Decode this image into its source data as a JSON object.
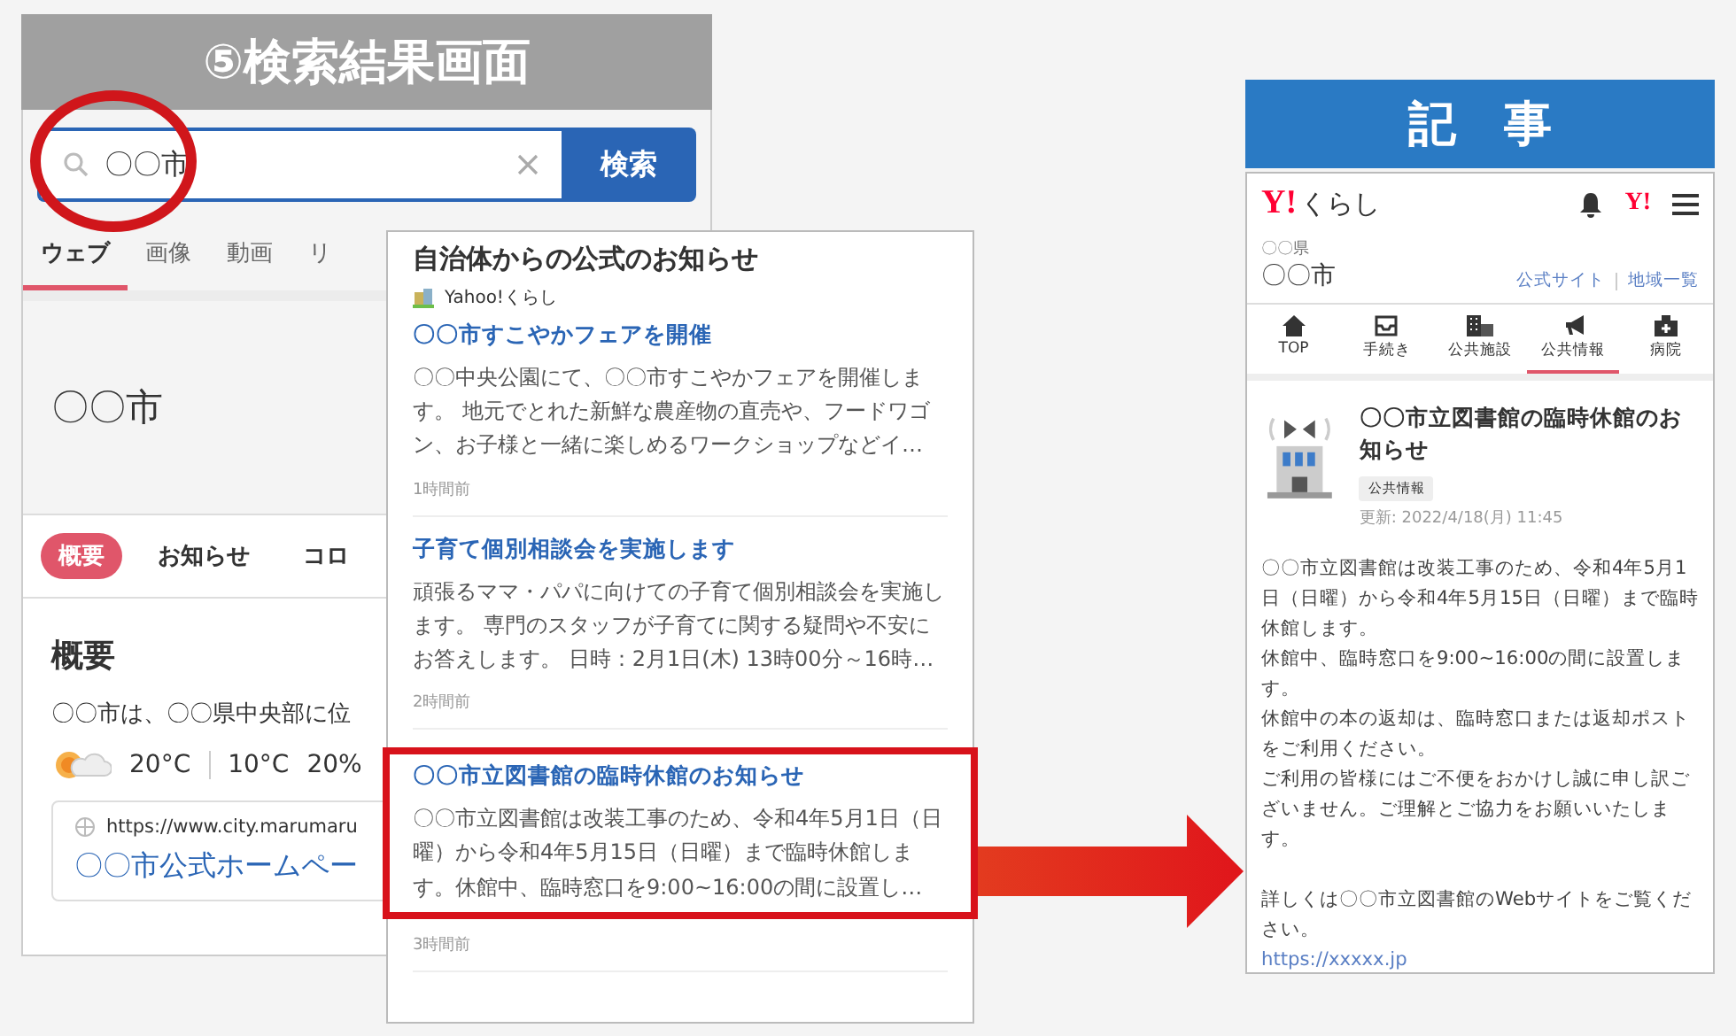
{
  "search_screen": {
    "title": "⑤検索結果画面",
    "search": {
      "value": "〇〇市",
      "button": "検索"
    },
    "tabs": [
      {
        "label": "ウェブ",
        "selected": true
      },
      {
        "label": "画像",
        "selected": false
      },
      {
        "label": "動画",
        "selected": false
      },
      {
        "label": "リ",
        "selected": false
      }
    ],
    "heading": "〇〇市",
    "chips": [
      {
        "label": "概要",
        "selected": true
      },
      {
        "label": "お知らせ",
        "selected": false
      },
      {
        "label": "コロ",
        "selected": false
      }
    ],
    "section_title": "概要",
    "summary": "〇〇市は、〇〇県中央部に位",
    "weather": {
      "high": "20°C",
      "low": "10°C",
      "rain": "20%"
    },
    "result": {
      "url": "https://www.city.marumaru",
      "title": "〇〇市公式ホームペー"
    }
  },
  "notices": {
    "title": "自治体からの公式のお知らせ",
    "source": "Yahoo!くらし",
    "items": [
      {
        "title": "〇〇市すこやかフェアを開催",
        "body": "〇〇中央公園にて、〇〇市すこやかフェアを開催します。 地元でとれた新鮮な農産物の直売や、フードワゴン、お子様と一緒に楽しめるワークショップなどイ…",
        "time": "1時間前",
        "highlighted": false
      },
      {
        "title": "子育て個別相談会を実施します",
        "body": "頑張るママ・パパに向けての子育て個別相談会を実施します。 専門のスタッフが子育てに関する疑問や不安にお答えします。 日時：2月1日(木) 13時00分～16時…",
        "time": "2時間前",
        "highlighted": false
      },
      {
        "title": "〇〇市立図書館の臨時休館のお知らせ",
        "body": "〇〇市立図書館は改装工事のため、令和4年5月1日（日曜）から令和4年5月15日（日曜）まで臨時休館します。休館中、臨時窓口を9:00~16:00の間に設置し…",
        "time": "3時間前",
        "highlighted": true
      }
    ]
  },
  "article_screen": {
    "title": "記　事",
    "logo": "Y!",
    "brand": "くらし",
    "account_logo": "Y!",
    "prefecture": "〇〇県",
    "city": "〇〇市",
    "links": [
      "公式サイト",
      "地域一覧"
    ],
    "nav": [
      {
        "label": "TOP",
        "kind": "home",
        "selected": false
      },
      {
        "label": "手続き",
        "kind": "tray",
        "selected": false
      },
      {
        "label": "公共施設",
        "kind": "building",
        "selected": false
      },
      {
        "label": "公共情報",
        "kind": "megaphone",
        "selected": true
      },
      {
        "label": "病院",
        "kind": "hospital",
        "selected": false
      }
    ],
    "article": {
      "title": "〇〇市立図書館の臨時休館のお知らせ",
      "tag": "公共情報",
      "updated": "更新: 2022/4/18(月) 11:45",
      "paragraphs": [
        "〇〇市立図書館は改装工事のため、令和4年5月1日（日曜）から令和4年5月15日（日曜）まで臨時休館します。",
        "休館中、臨時窓口を9:00~16:00の間に設置します。",
        "休館中の本の返却は、臨時窓口または返却ポストをご利用ください。",
        "ご利用の皆様にはご不便をおかけし誠に申し訳ございません。ご理解とご協力をお願いいたします。"
      ],
      "more": "詳しくは〇〇市立図書館のWebサイトをご覧ください。",
      "link": "https://xxxxx.jp"
    }
  }
}
